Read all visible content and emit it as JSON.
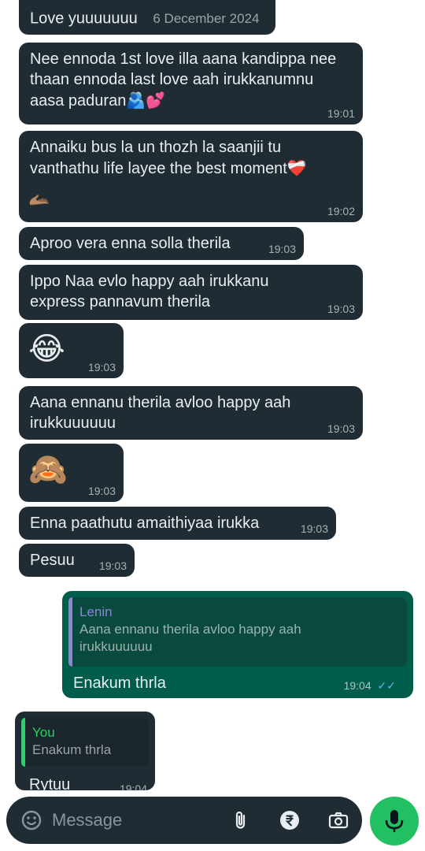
{
  "messages": [
    {
      "text": "Love yuuuuuuu",
      "date_chip": "6 December 2024"
    },
    {
      "text": "Nee ennoda 1st love illa aana kandippa nee thaan ennoda last love aah irukkanumnu aasa paduran",
      "emoji": "🫂💕",
      "time": "19:01"
    },
    {
      "text": "Annaiku bus la un thozh la saanjii tu vanthathu life layee the best moment",
      "emoji": "❤️‍🩹",
      "emoji2": "🫴🏽",
      "time": "19:02"
    },
    {
      "text": "Aproo vera enna solla therila",
      "time": "19:03"
    },
    {
      "text": "Ippo Naa evlo happy aah irukkanu express pannavum therila",
      "time": "19:03"
    },
    {
      "emoji": "😂",
      "time": "19:03"
    },
    {
      "text": "Aana ennanu therila avloo happy aah irukkuuuuuu",
      "time": "19:03"
    },
    {
      "emoji": "🙈",
      "time": "19:03"
    },
    {
      "text": "Enna paathutu amaithiyaa irukka",
      "time": "19:03"
    },
    {
      "text": "Pesuu",
      "time": "19:03"
    }
  ],
  "outgoing": {
    "quote_author": "Lenin",
    "quote_text": "Aana ennanu therila avloo happy aah irukkuuuuuu",
    "text": "Enakum thrla",
    "time": "19:04",
    "ticks": "✓✓"
  },
  "reply_in": {
    "quote_author": "You",
    "quote_text": "Enakum thrla",
    "text": "Rytuu",
    "time": "19:04"
  },
  "composer": {
    "placeholder": "Message",
    "icons": [
      "emoji-icon",
      "attach-icon",
      "rupee-icon",
      "camera-icon",
      "mic-icon"
    ]
  },
  "colors": {
    "incoming_bubble": "#1f2c34",
    "outgoing_bubble": "#005c4b",
    "accent_green": "#21c063",
    "quote_purple": "#8e84d8",
    "quote_green": "#25d366",
    "read_tick": "#53bdeb"
  }
}
